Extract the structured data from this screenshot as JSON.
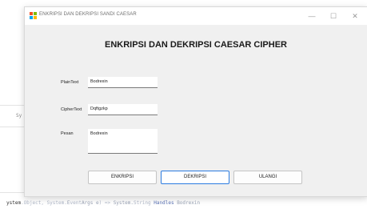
{
  "background": {
    "side_label": "Sy",
    "code_line": {
      "part1": "ystem",
      "part2": ".Object, System.",
      "part3": "E",
      "part4": "vent",
      "part5": "Args e",
      "part6": ") => ",
      "part7": "System.",
      "part8": "String",
      "part9": " Handles ",
      "part10": "Bodrexin"
    }
  },
  "window": {
    "title": "ENKRIPSI DAN DEKRIPSI SANDI CAESAR",
    "controls": {
      "minimize": "—",
      "maximize": "☐",
      "close": "✕"
    },
    "heading": "ENKRIPSI DAN DEKRIPSI CAESAR CIPHER",
    "fields": {
      "plaintext": {
        "label": "PlainText",
        "value": "Bodrexin"
      },
      "ciphertext": {
        "label": "CipherText",
        "value": "Dqftgzkp"
      },
      "pesan": {
        "label": "Pesan",
        "value": "Bodrexin"
      }
    },
    "buttons": {
      "enkripsi": "ENKRIPSI",
      "dekripsi": "DEKRIPSI",
      "ulangi": "ULANGI"
    }
  },
  "colors": {
    "window_bg": "#f0f0f0",
    "accent": "#2b7be0",
    "titlebar": "#ffffff"
  }
}
